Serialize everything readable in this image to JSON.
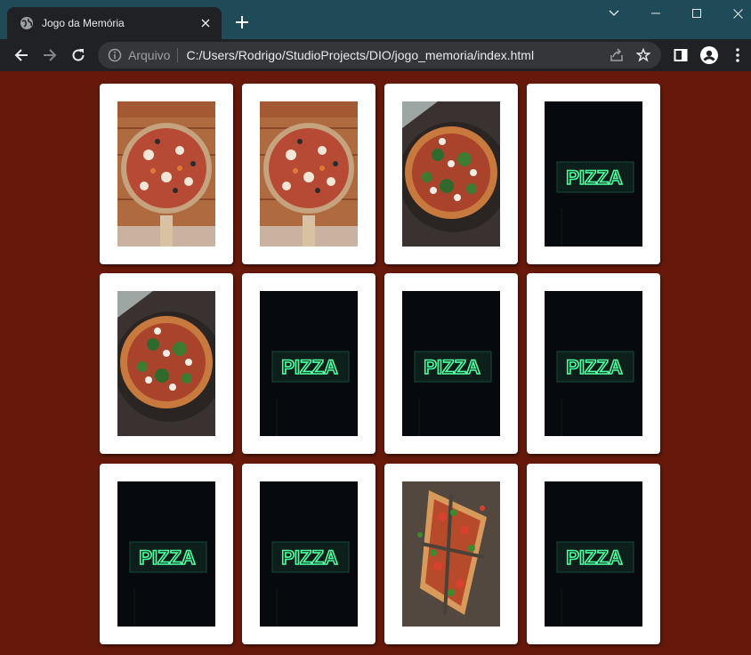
{
  "browser": {
    "tab_title": "Jogo da Memória",
    "address_prefix": "Arquivo",
    "url": "C:/Users/Rodrigo/StudioProjects/DIO/jogo_memoria/index.html"
  },
  "board": {
    "columns": 4,
    "cards": [
      {
        "position": 1,
        "face": "pizza-on-wooden-table"
      },
      {
        "position": 2,
        "face": "pizza-on-wooden-table"
      },
      {
        "position": 3,
        "face": "pizza-with-greens"
      },
      {
        "position": 4,
        "face": "neon-pizza-sign"
      },
      {
        "position": 5,
        "face": "pizza-with-greens"
      },
      {
        "position": 6,
        "face": "neon-pizza-sign"
      },
      {
        "position": 7,
        "face": "neon-pizza-sign"
      },
      {
        "position": 8,
        "face": "neon-pizza-sign"
      },
      {
        "position": 9,
        "face": "neon-pizza-sign"
      },
      {
        "position": 10,
        "face": "neon-pizza-sign"
      },
      {
        "position": 11,
        "face": "sliced-pizza-top-view"
      },
      {
        "position": 12,
        "face": "neon-pizza-sign"
      }
    ],
    "neon_sign_text": "PIZZA"
  },
  "colors": {
    "page_background": "#66190a",
    "card_background": "#ffffff",
    "titlebar": "#1e4b57",
    "toolbar": "#202124",
    "neon_green": "#4dffa0"
  },
  "icons": [
    "globe-icon",
    "tab-close-icon",
    "new-tab-icon",
    "chevron-down-icon",
    "minimize-icon",
    "maximize-icon",
    "window-close-icon",
    "back-icon",
    "forward-icon",
    "reload-icon",
    "info-icon",
    "share-icon",
    "star-icon",
    "side-panel-icon",
    "profile-icon",
    "menu-icon"
  ]
}
